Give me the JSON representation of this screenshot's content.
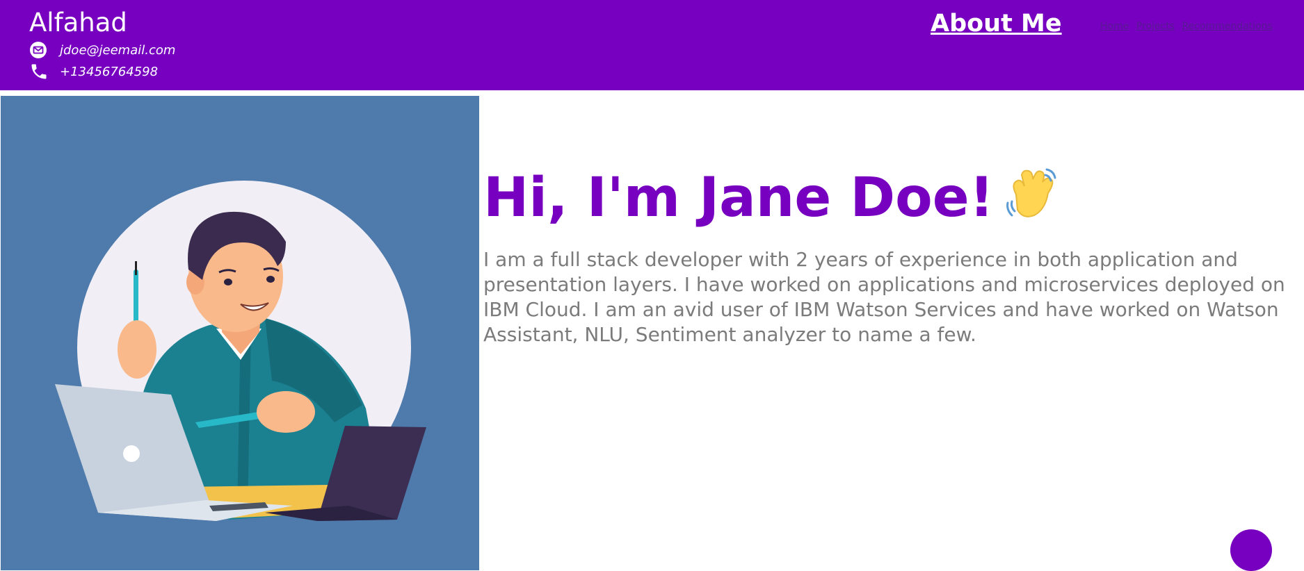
{
  "header": {
    "brand": "Alfahad",
    "email": "jdoe@jeemail.com",
    "phone": "+13456764598",
    "nav_title": "About Me",
    "nav_links": [
      "Home",
      "Projects",
      "Recommendations"
    ]
  },
  "hero": {
    "greeting": "Hi, I'm Jane Doe!",
    "bio": "I am a full stack developer with 2 years of experience in both application and presentation layers. I have worked on applications and microservices deployed on IBM Cloud. I am an avid user of IBM Watson Services and have worked on Watson Assistant, NLU, Sentiment analyzer to name a few."
  },
  "icons": {
    "email": "mail-icon",
    "phone": "phone-icon",
    "wave": "waving-hand-icon",
    "illustration": "developer-illustration"
  },
  "colors": {
    "brand": "#7700c0",
    "header_text": "#ffffff",
    "body_text": "#7b7b7b",
    "image_bg": "#4e7bab"
  }
}
